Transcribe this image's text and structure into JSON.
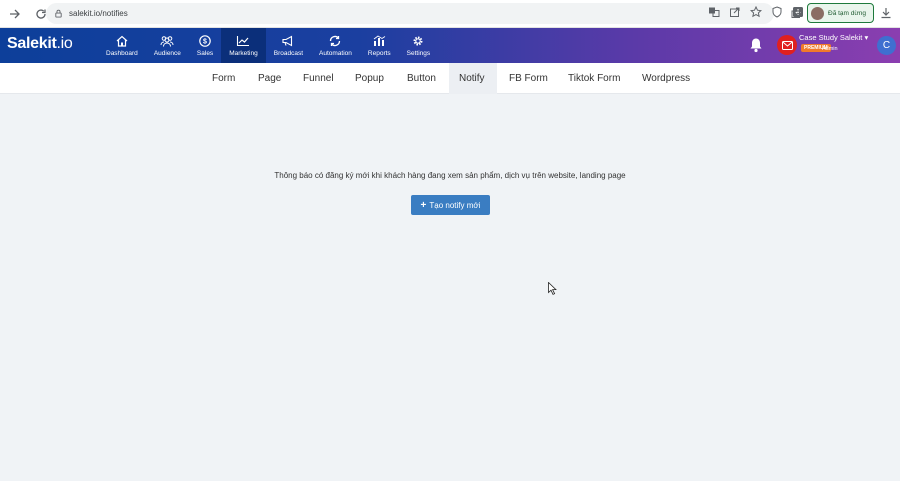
{
  "browser": {
    "url": "salekit.io/notifies",
    "paused_label": "Đã tạm dừng"
  },
  "header": {
    "logo_main": "Salekit",
    "logo_suffix": ".io",
    "menu": [
      {
        "label": "Dashboard",
        "icon": "home-icon"
      },
      {
        "label": "Audience",
        "icon": "users-icon"
      },
      {
        "label": "Sales",
        "icon": "dollar-icon"
      },
      {
        "label": "Marketing",
        "icon": "chart-line-icon"
      },
      {
        "label": "Broadcast",
        "icon": "megaphone-icon"
      },
      {
        "label": "Automation",
        "icon": "sync-icon"
      },
      {
        "label": "Reports",
        "icon": "bar-chart-icon"
      },
      {
        "label": "Settings",
        "icon": "gear-icon"
      }
    ],
    "active_menu": "Marketing",
    "account_name": "Case Study Salekit",
    "plan_badge": "PREMIUM",
    "role": "Admin",
    "avatar_letter": "C"
  },
  "subnav": {
    "tabs": [
      "Form",
      "Page",
      "Funnel",
      "Popup",
      "Button",
      "Notify",
      "FB Form",
      "Tiktok Form",
      "Wordpress"
    ],
    "active_tab": "Notify"
  },
  "main": {
    "notice": "Thông báo có đăng ký mới khi khách hàng đang xem sản phẩm, dịch vụ trên website, landing page",
    "create_button": "Tạo notify mới"
  },
  "colors": {
    "header_start": "#0d3f9a",
    "header_end": "#8b3eb0",
    "button": "#3a7dc2",
    "badge": "#f07a2a"
  }
}
